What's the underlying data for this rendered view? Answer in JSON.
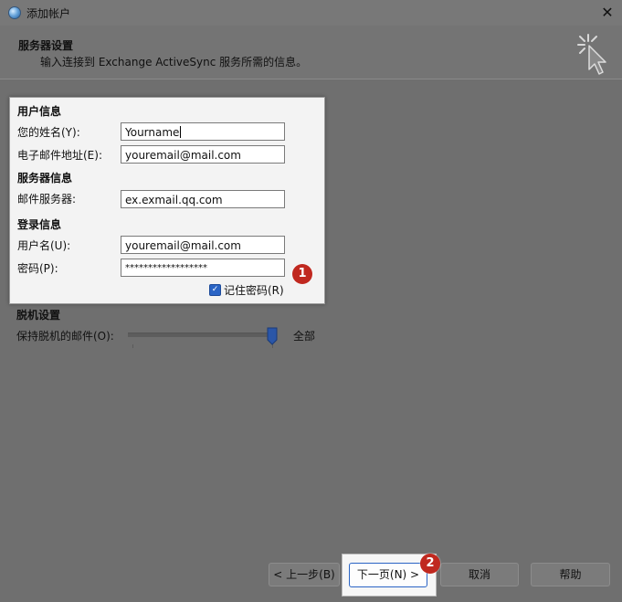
{
  "window": {
    "title": "添加帐户",
    "close_glyph": "✕",
    "icon": "globe-icon"
  },
  "header": {
    "title": "服务器设置",
    "subtitle": "输入连接到 Exchange ActiveSync 服务所需的信息。",
    "icon": "cursor-click-icon"
  },
  "user_info": {
    "section": "用户信息",
    "name_label": "您的姓名(Y):",
    "name_value": "Yourname",
    "email_label": "电子邮件地址(E):",
    "email_value": "youremail@mail.com"
  },
  "server_info": {
    "section": "服务器信息",
    "server_label": "邮件服务器:",
    "server_value": "ex.exmail.qq.com"
  },
  "login_info": {
    "section": "登录信息",
    "username_label": "用户名(U):",
    "username_value": "youremail@mail.com",
    "password_label": "密码(P):",
    "password_value": "******************",
    "remember_label": "记住密码(R)",
    "remember_checked": true
  },
  "offline": {
    "section": "脱机设置",
    "keep_label": "保持脱机的邮件(O):",
    "slider_value_label": "全部",
    "slider_level": 1.0
  },
  "footer": {
    "back_label": "< 上一步(B)",
    "next_label": "下一页(N) >",
    "cancel_label": "取消",
    "help_label": "帮助"
  },
  "annotations": {
    "badge1": "1",
    "badge2": "2",
    "badge_color": "#c0281f"
  },
  "colors": {
    "accent": "#2a64c5",
    "dim_overlay": "#6f6f6f"
  }
}
